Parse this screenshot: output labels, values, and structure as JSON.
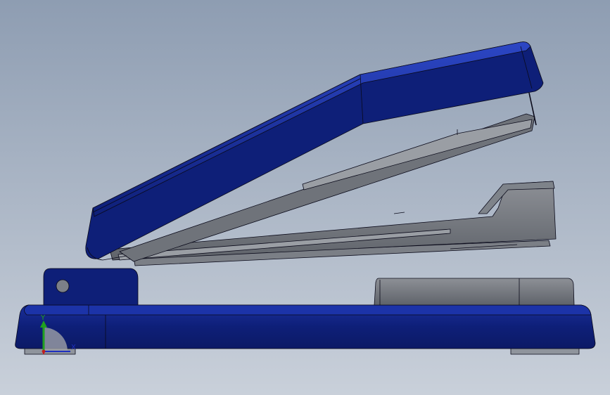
{
  "viewport": {
    "background_top": "#8e9db2",
    "background_bottom": "#c9d0da"
  },
  "model": {
    "part_color": "#0e1f78",
    "part_highlight": "#2c46c4",
    "metal_color": "#6a6e74",
    "metal_light": "#8d9096",
    "edge_color": "#0a0a1a"
  },
  "triad": {
    "y_label": "Y",
    "x_label": "X",
    "y_color": "#1fa01f",
    "x_color": "#1f2fc0",
    "z_color": "#c01f1f"
  }
}
